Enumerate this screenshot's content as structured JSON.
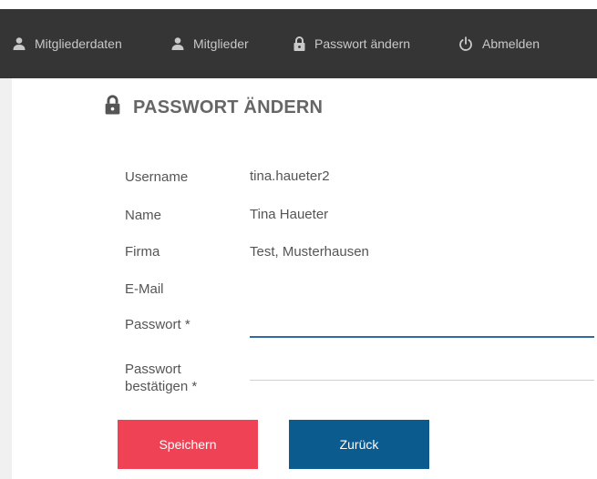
{
  "nav": {
    "items": [
      {
        "label": "Mitgliederdaten",
        "icon": "person-icon"
      },
      {
        "label": "Mitglieder",
        "icon": "person-icon"
      },
      {
        "label": "Passwort ändern",
        "icon": "lock-icon"
      },
      {
        "label": "Abmelden",
        "icon": "power-icon"
      }
    ]
  },
  "page": {
    "title": "PASSWORT ÄNDERN",
    "title_icon": "lock-icon"
  },
  "form": {
    "username_label": "Username",
    "username_value": "tina.haueter2",
    "name_label": "Name",
    "name_value": "Tina Haueter",
    "firma_label": "Firma",
    "firma_value": "Test, Musterhausen",
    "email_label": "E-Mail",
    "email_value": "",
    "password_label": "Passwort *",
    "password_value": "",
    "confirm_label_line1": "Passwort",
    "confirm_label_line2": "bestätigen *",
    "confirm_value": ""
  },
  "buttons": {
    "save_label": "Speichern",
    "back_label": "Zurück"
  },
  "colors": {
    "navbar_bg": "#353535",
    "save_button": "#f04255",
    "back_button": "#0b5b8f",
    "input_focus": "#2e6da4"
  }
}
